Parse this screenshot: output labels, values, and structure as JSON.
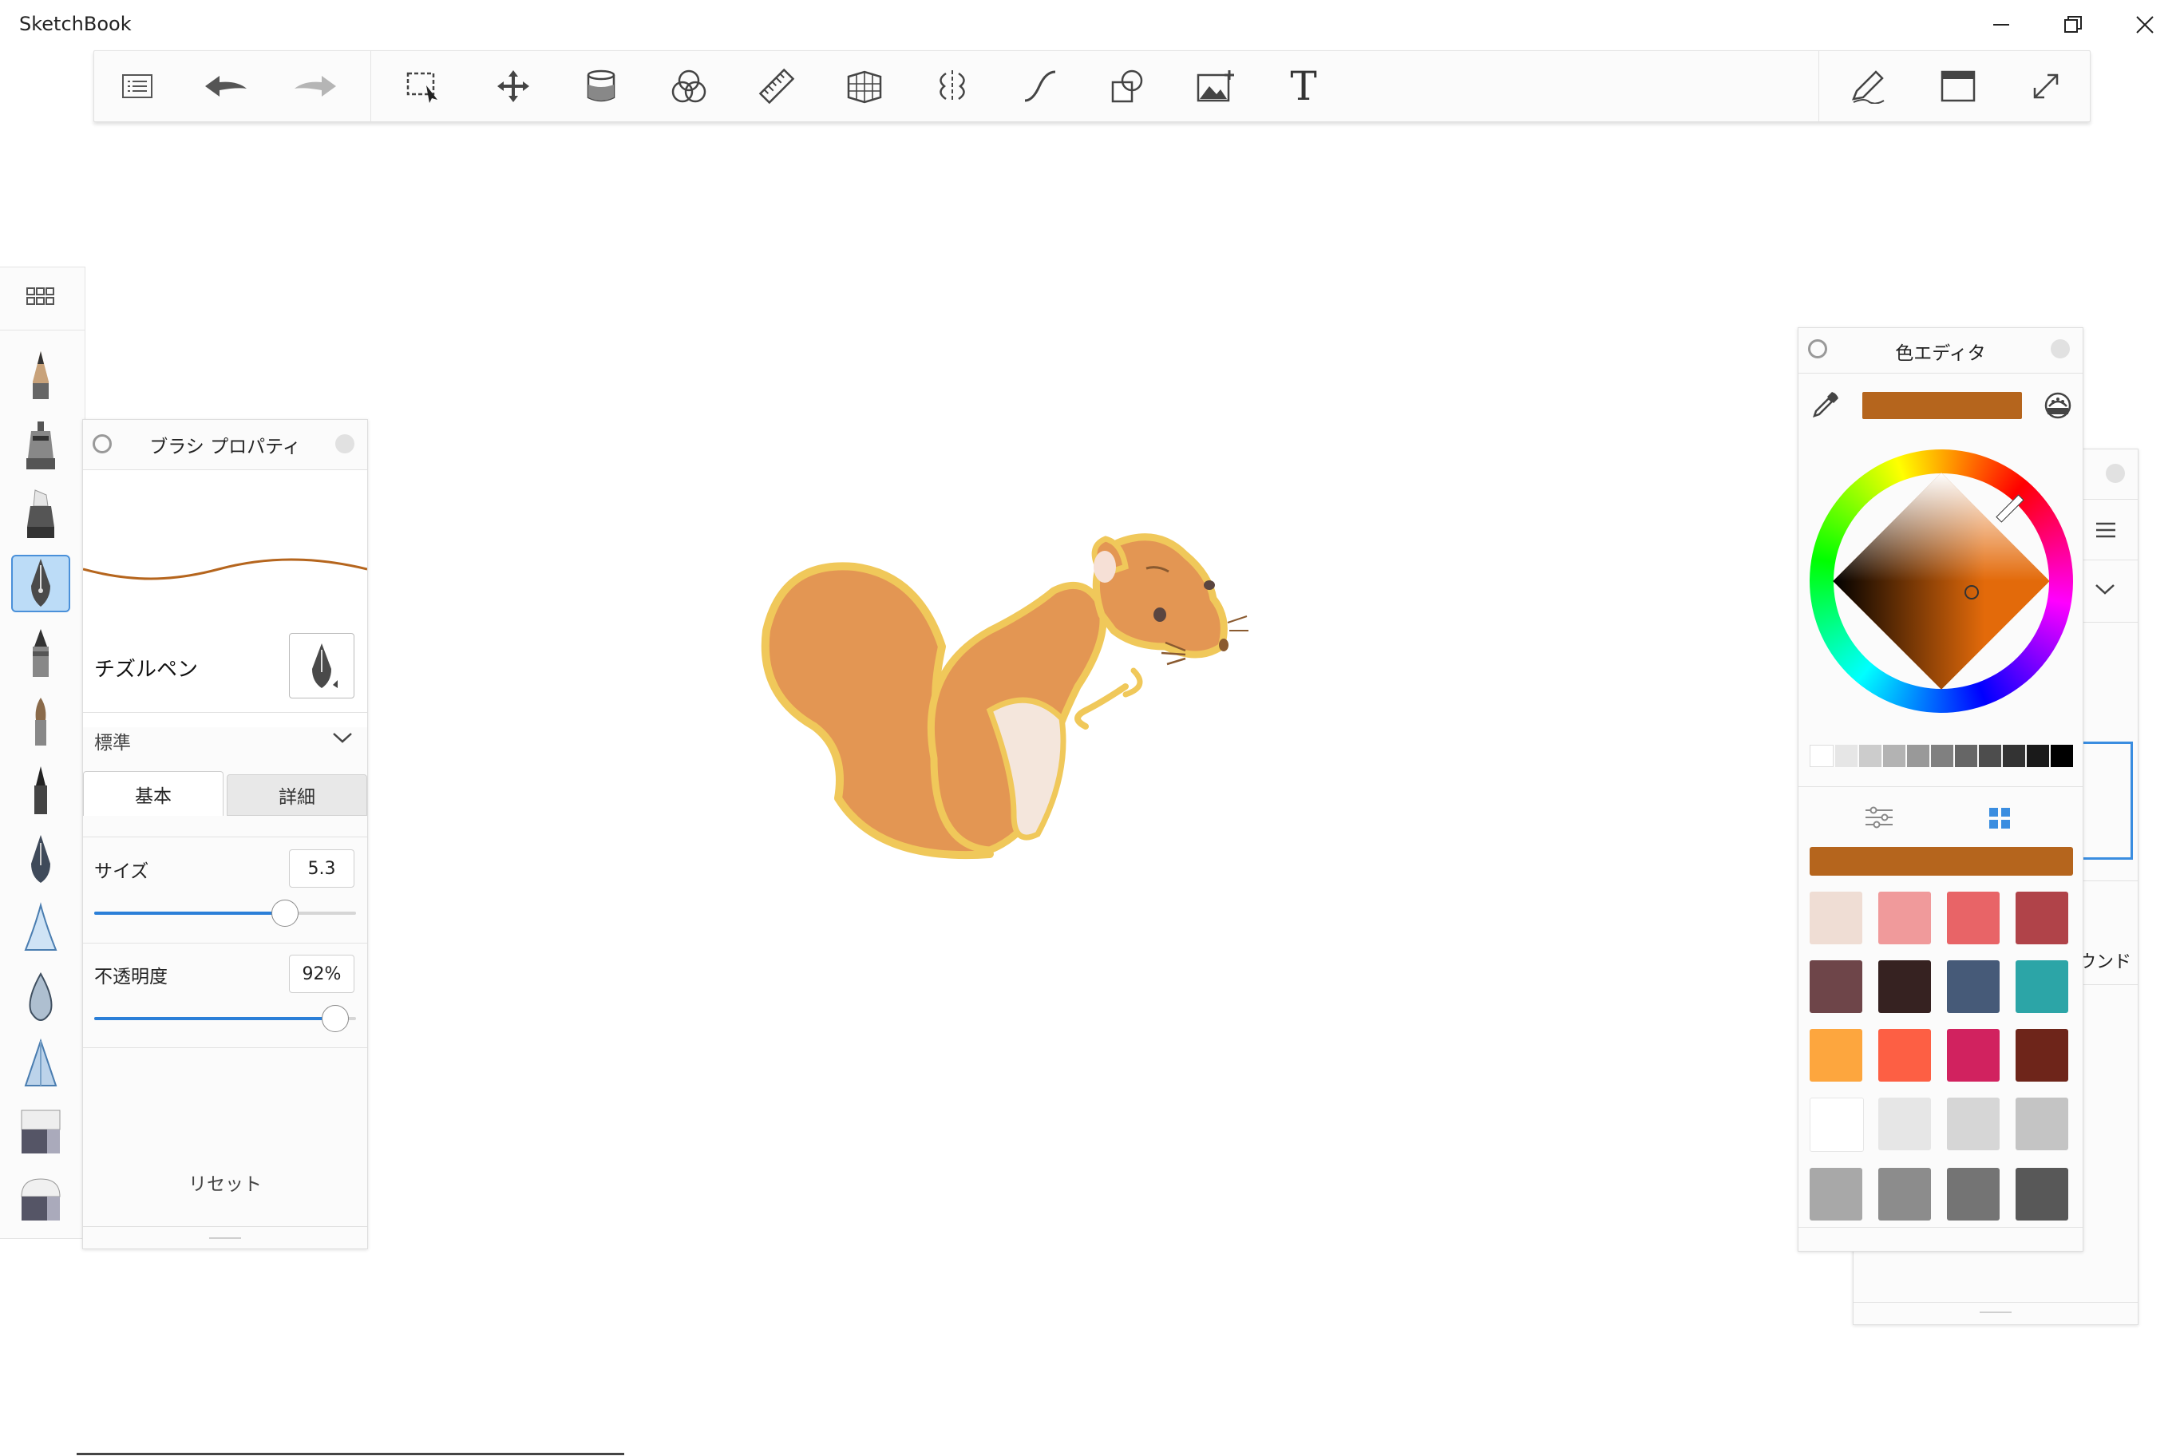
{
  "app": {
    "title": "SketchBook"
  },
  "window_controls": {
    "minimize_icon": "minimize-icon",
    "restore_icon": "restore-icon",
    "close_icon": "close-icon"
  },
  "toolbar": {
    "tools": [
      "list-menu-icon",
      "undo-icon",
      "redo-icon",
      "selection-icon",
      "transform-icon",
      "fill-icon",
      "color-mixer-icon",
      "ruler-icon",
      "perspective-icon",
      "symmetry-icon",
      "curve-icon",
      "shape-icon",
      "image-insert-icon",
      "text-icon"
    ],
    "text_tool_label": "T",
    "right_tools": [
      "pen-icon",
      "window-icon",
      "fullscreen-icon"
    ]
  },
  "brush_library": {
    "brushes": [
      "pencil",
      "airbrush",
      "marker",
      "chisel-pen",
      "ballpoint",
      "paint-brush",
      "fine-pen",
      "ink-pen",
      "triangle",
      "water-drop",
      "cone",
      "eraser-hard",
      "eraser-soft"
    ],
    "selected": "chisel-pen"
  },
  "brush_properties": {
    "title": "ブラシ プロパティ",
    "brush_name": "チズルペン",
    "preset": "標準",
    "tabs": [
      {
        "label": "基本",
        "active": true
      },
      {
        "label": "詳細",
        "active": false
      }
    ],
    "size": {
      "label": "サイズ",
      "value": "5.3",
      "fraction": 0.73
    },
    "opacity": {
      "label": "不透明度",
      "value": "92%",
      "fraction": 0.92
    },
    "reset_label": "リセット"
  },
  "color_editor": {
    "title": "色エディタ",
    "current_color": "#B5651D",
    "grayscale": [
      "#ffffff",
      "#e6e6e6",
      "#cccccc",
      "#b3b3b3",
      "#999999",
      "#808080",
      "#666666",
      "#4d4d4d",
      "#333333",
      "#1a1a1a",
      "#000000"
    ],
    "swatches": [
      "#efddd4",
      "#f09a9b",
      "#e86467",
      "#b04349",
      "#6e4549",
      "#362221",
      "#465a78",
      "#2ca5a7",
      "#fda63e",
      "#fd5f44",
      "#d1225f",
      "#6e251a",
      "#ffffff",
      "#e6e6e6",
      "#d6d6d6",
      "#c4c4c4",
      "#a8a8a8",
      "#8c8c8c",
      "#747474",
      "#585858"
    ]
  },
  "layer_panel": {
    "partial_label": "ウンド"
  }
}
